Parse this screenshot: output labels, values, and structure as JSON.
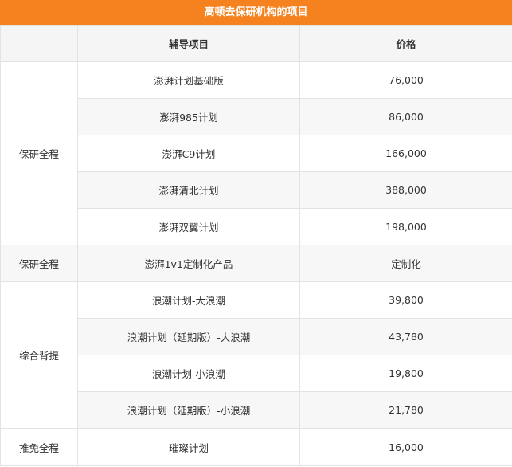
{
  "title": "高顿去保研机构的项目",
  "headers": [
    "",
    "辅导项目",
    "价格"
  ],
  "groups": [
    {
      "name": "保研全程",
      "rows": [
        {
          "item": "澎湃计划基础版",
          "price": "76,000"
        },
        {
          "item": "澎湃985计划",
          "price": "86,000"
        },
        {
          "item": "澎湃C9计划",
          "price": "166,000"
        },
        {
          "item": "澎湃清北计划",
          "price": "388,000"
        },
        {
          "item": "澎湃双翼计划",
          "price": "198,000"
        }
      ]
    },
    {
      "name": "保研全程",
      "rows": [
        {
          "item": "澎湃1v1定制化产品",
          "price": "定制化"
        }
      ]
    },
    {
      "name": "综合背提",
      "rows": [
        {
          "item": "浪潮计划-大浪潮",
          "price": "39,800"
        },
        {
          "item": "浪潮计划（延期版）-大浪潮",
          "price": "43,780"
        },
        {
          "item": "浪潮计划-小浪潮",
          "price": "19,800"
        },
        {
          "item": "浪潮计划（延期版）-小浪潮",
          "price": "21,780"
        }
      ]
    },
    {
      "name": "推免全程",
      "rows": [
        {
          "item": "璀璨计划",
          "price": "16,000"
        }
      ]
    }
  ],
  "colors": {
    "header_bar": "#f5821f",
    "header_row_bg": "#f5f5f5",
    "alt_row_bg": "#f7f7f7",
    "border": "#e3e3e3"
  }
}
